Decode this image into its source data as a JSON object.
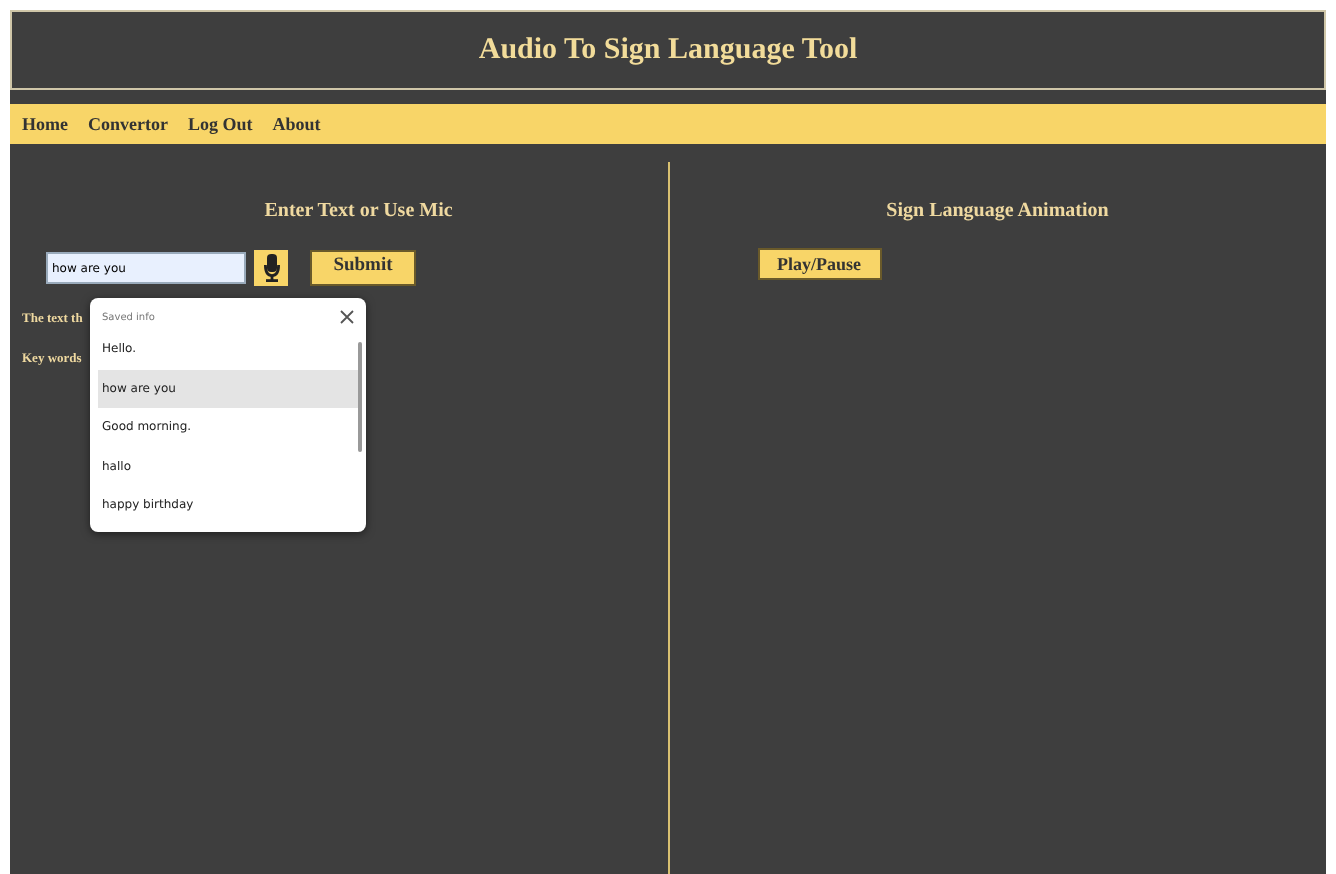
{
  "header": {
    "title": "Audio To Sign Language Tool"
  },
  "nav": [
    {
      "label": "Home"
    },
    {
      "label": "Convertor"
    },
    {
      "label": "Log Out"
    },
    {
      "label": "About"
    }
  ],
  "left": {
    "heading": "Enter Text or Use Mic",
    "input": {
      "value": "how are you"
    },
    "submit": "Submit",
    "lines": [
      "The text th",
      "Key words"
    ]
  },
  "autocomplete": {
    "title": "Saved info",
    "items": [
      {
        "label": "Hello.",
        "selected": false
      },
      {
        "label": "how are you",
        "selected": true
      },
      {
        "label": "Good morning.",
        "selected": false
      },
      {
        "label": "hallo",
        "selected": false
      },
      {
        "label": "happy birthday",
        "selected": false
      }
    ]
  },
  "right": {
    "heading": "Sign Language Animation",
    "button": "Play/Pause"
  }
}
